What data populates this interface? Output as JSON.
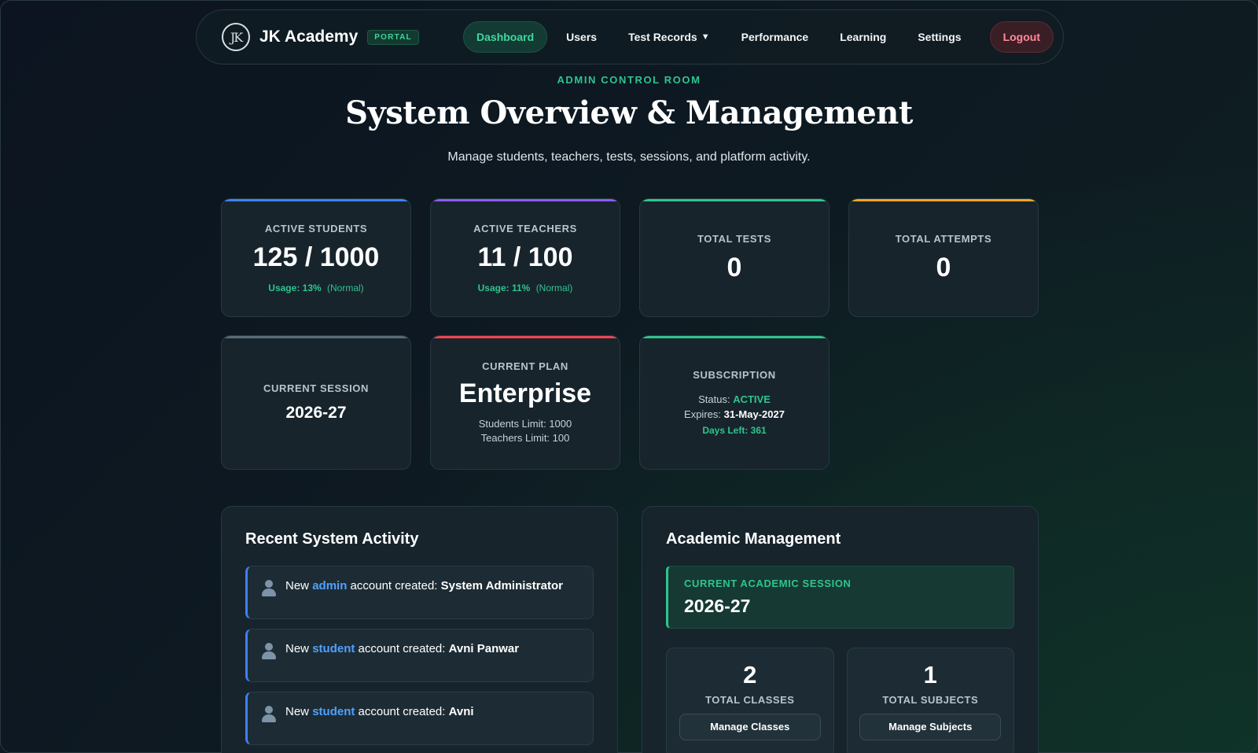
{
  "nav": {
    "brand_logo_text": "JK",
    "brand_name": "JK Academy",
    "portal_badge": "PORTAL",
    "links": [
      "Dashboard",
      "Users",
      "Test Records",
      "Performance",
      "Learning",
      "Settings"
    ],
    "active": "Dashboard",
    "logout": "Logout",
    "caret": "▼"
  },
  "hero": {
    "eyebrow": "ADMIN CONTROL ROOM",
    "title": "System Overview & Management",
    "subtitle": "Manage students, teachers, tests, sessions, and platform activity."
  },
  "stats": {
    "students": {
      "label": "ACTIVE STUDENTS",
      "value": "125 / 1000",
      "usage": "Usage: 13%",
      "status": "(Normal)"
    },
    "teachers": {
      "label": "ACTIVE TEACHERS",
      "value": "11 / 100",
      "usage": "Usage: 11%",
      "status": "(Normal)"
    },
    "tests": {
      "label": "TOTAL TESTS",
      "value": "0"
    },
    "attempts": {
      "label": "TOTAL ATTEMPTS",
      "value": "0"
    },
    "session": {
      "label": "CURRENT SESSION",
      "value": "2026-27"
    },
    "plan": {
      "label": "CURRENT PLAN",
      "value": "Enterprise",
      "students_limit": "Students Limit: 1000",
      "teachers_limit": "Teachers Limit: 100"
    },
    "subscription": {
      "label": "SUBSCRIPTION",
      "status_label": "Status:",
      "status_value": "ACTIVE",
      "expires_label": "Expires:",
      "expires_value": "31-May-2027",
      "days_left": "Days Left: 361"
    }
  },
  "activity": {
    "title": "Recent System Activity",
    "items": [
      {
        "prefix": "New",
        "role": "admin",
        "mid": "account created:",
        "name": "System Administrator"
      },
      {
        "prefix": "New",
        "role": "student",
        "mid": "account created:",
        "name": "Avni Panwar"
      },
      {
        "prefix": "New",
        "role": "student",
        "mid": "account created:",
        "name": "Avni"
      }
    ]
  },
  "academic": {
    "title": "Academic Management",
    "session_label": "CURRENT ACADEMIC SESSION",
    "session_value": "2026-27",
    "classes": {
      "count": "2",
      "label": "TOTAL CLASSES",
      "button": "Manage Classes"
    },
    "subjects": {
      "count": "1",
      "label": "TOTAL SUBJECTS",
      "button": "Manage Subjects"
    }
  },
  "colors": {
    "accent_green": "#2fc48e",
    "accent_blue": "#3b82f6",
    "accent_purple": "#8b5cf6",
    "accent_amber": "#f5a524",
    "accent_red": "#ef4452",
    "accent_slate": "#5a6b78"
  }
}
